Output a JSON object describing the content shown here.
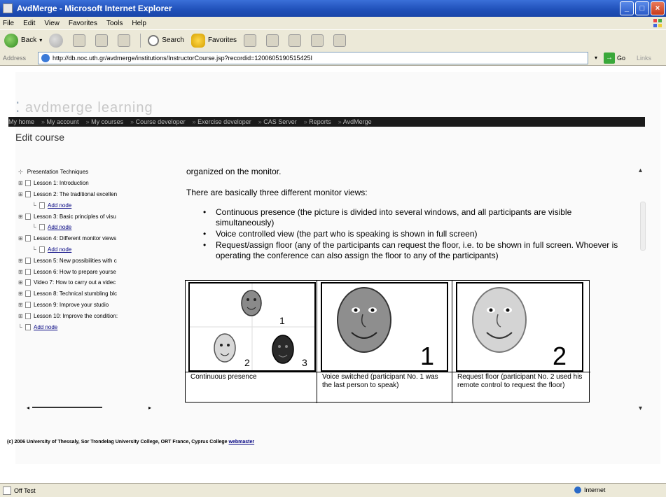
{
  "window": {
    "title": "AvdMerge - Microsoft Internet Explorer"
  },
  "menu": [
    "File",
    "Edit",
    "View",
    "Favorites",
    "Tools",
    "Help"
  ],
  "toolbar": {
    "back": "Back",
    "search": "Search",
    "favorites": "Favorites"
  },
  "address": {
    "label": "Address",
    "url": "http://db.noc.uth.gr/avdmerge/institutions/InstructorCourse.jsp?recordid=1200605190515425I",
    "go": "Go",
    "links": "Links"
  },
  "site": {
    "logo": "avdmerge learning",
    "nav": [
      "My home",
      "My account",
      "My courses",
      "Course developer",
      "Exercise developer",
      "CAS Server",
      "Reports",
      "AvdMerge"
    ],
    "page_title": "Edit course"
  },
  "tree": {
    "root": "Presentation Techniques",
    "nodes": [
      {
        "type": "lesson",
        "label": "Lesson 1: Introduction"
      },
      {
        "type": "lesson",
        "label": "Lesson 2: The traditional excellen"
      },
      {
        "type": "add",
        "label": "Add node"
      },
      {
        "type": "lesson",
        "label": "Lesson 3: Basic principles of visu"
      },
      {
        "type": "add",
        "label": "Add node"
      },
      {
        "type": "lesson",
        "label": "Lesson 4: Different monitor views"
      },
      {
        "type": "add",
        "label": "Add node"
      },
      {
        "type": "lesson",
        "label": "Lesson 5: New possibilities with c"
      },
      {
        "type": "lesson",
        "label": "Lesson 6: How to prepare yourse"
      },
      {
        "type": "lesson",
        "label": "Video 7: How to carry out a videc"
      },
      {
        "type": "lesson",
        "label": "Lesson 8: Technical stumbling blc"
      },
      {
        "type": "lesson",
        "label": "Lesson 9: Improve your studio"
      },
      {
        "type": "lesson",
        "label": "Lesson 10: Improve the condition:"
      },
      {
        "type": "add-root",
        "label": "Add node"
      }
    ]
  },
  "content": {
    "intro_fragment": "organized on the monitor.",
    "lead": "There are basically three different monitor views:",
    "bullets": [
      "Continuous presence (the picture is divided into several windows, and all participants are visible simultaneously)",
      "Voice controlled view (the part who is speaking is shown in full screen)",
      "Request/assign floor (any of the participants can request the floor, i.e. to be shown in full screen. Whoever is operating the conference can also assign the floor to any of the participants)"
    ],
    "views": [
      {
        "caption": "Continuous presence",
        "labels": [
          "1",
          "2",
          "3"
        ]
      },
      {
        "caption": "Voice switched (participant No. 1 was the last person to speak)",
        "number": "1"
      },
      {
        "caption": "Request floor (participant No. 2 used his remote control to request the floor)",
        "number": "2"
      }
    ]
  },
  "footer": {
    "text": "(c) 2006 University of Thessaly, Sor Trondelag University College, ORT France, Cyprus College",
    "webmaster": "webmaster"
  },
  "status": {
    "left": "Off Test",
    "zone": "Internet"
  },
  "colors": {
    "titlebar": "#1f4fb8",
    "chrome": "#ece9d8",
    "site_nav": "#1a1a1a",
    "link": "#000080"
  }
}
